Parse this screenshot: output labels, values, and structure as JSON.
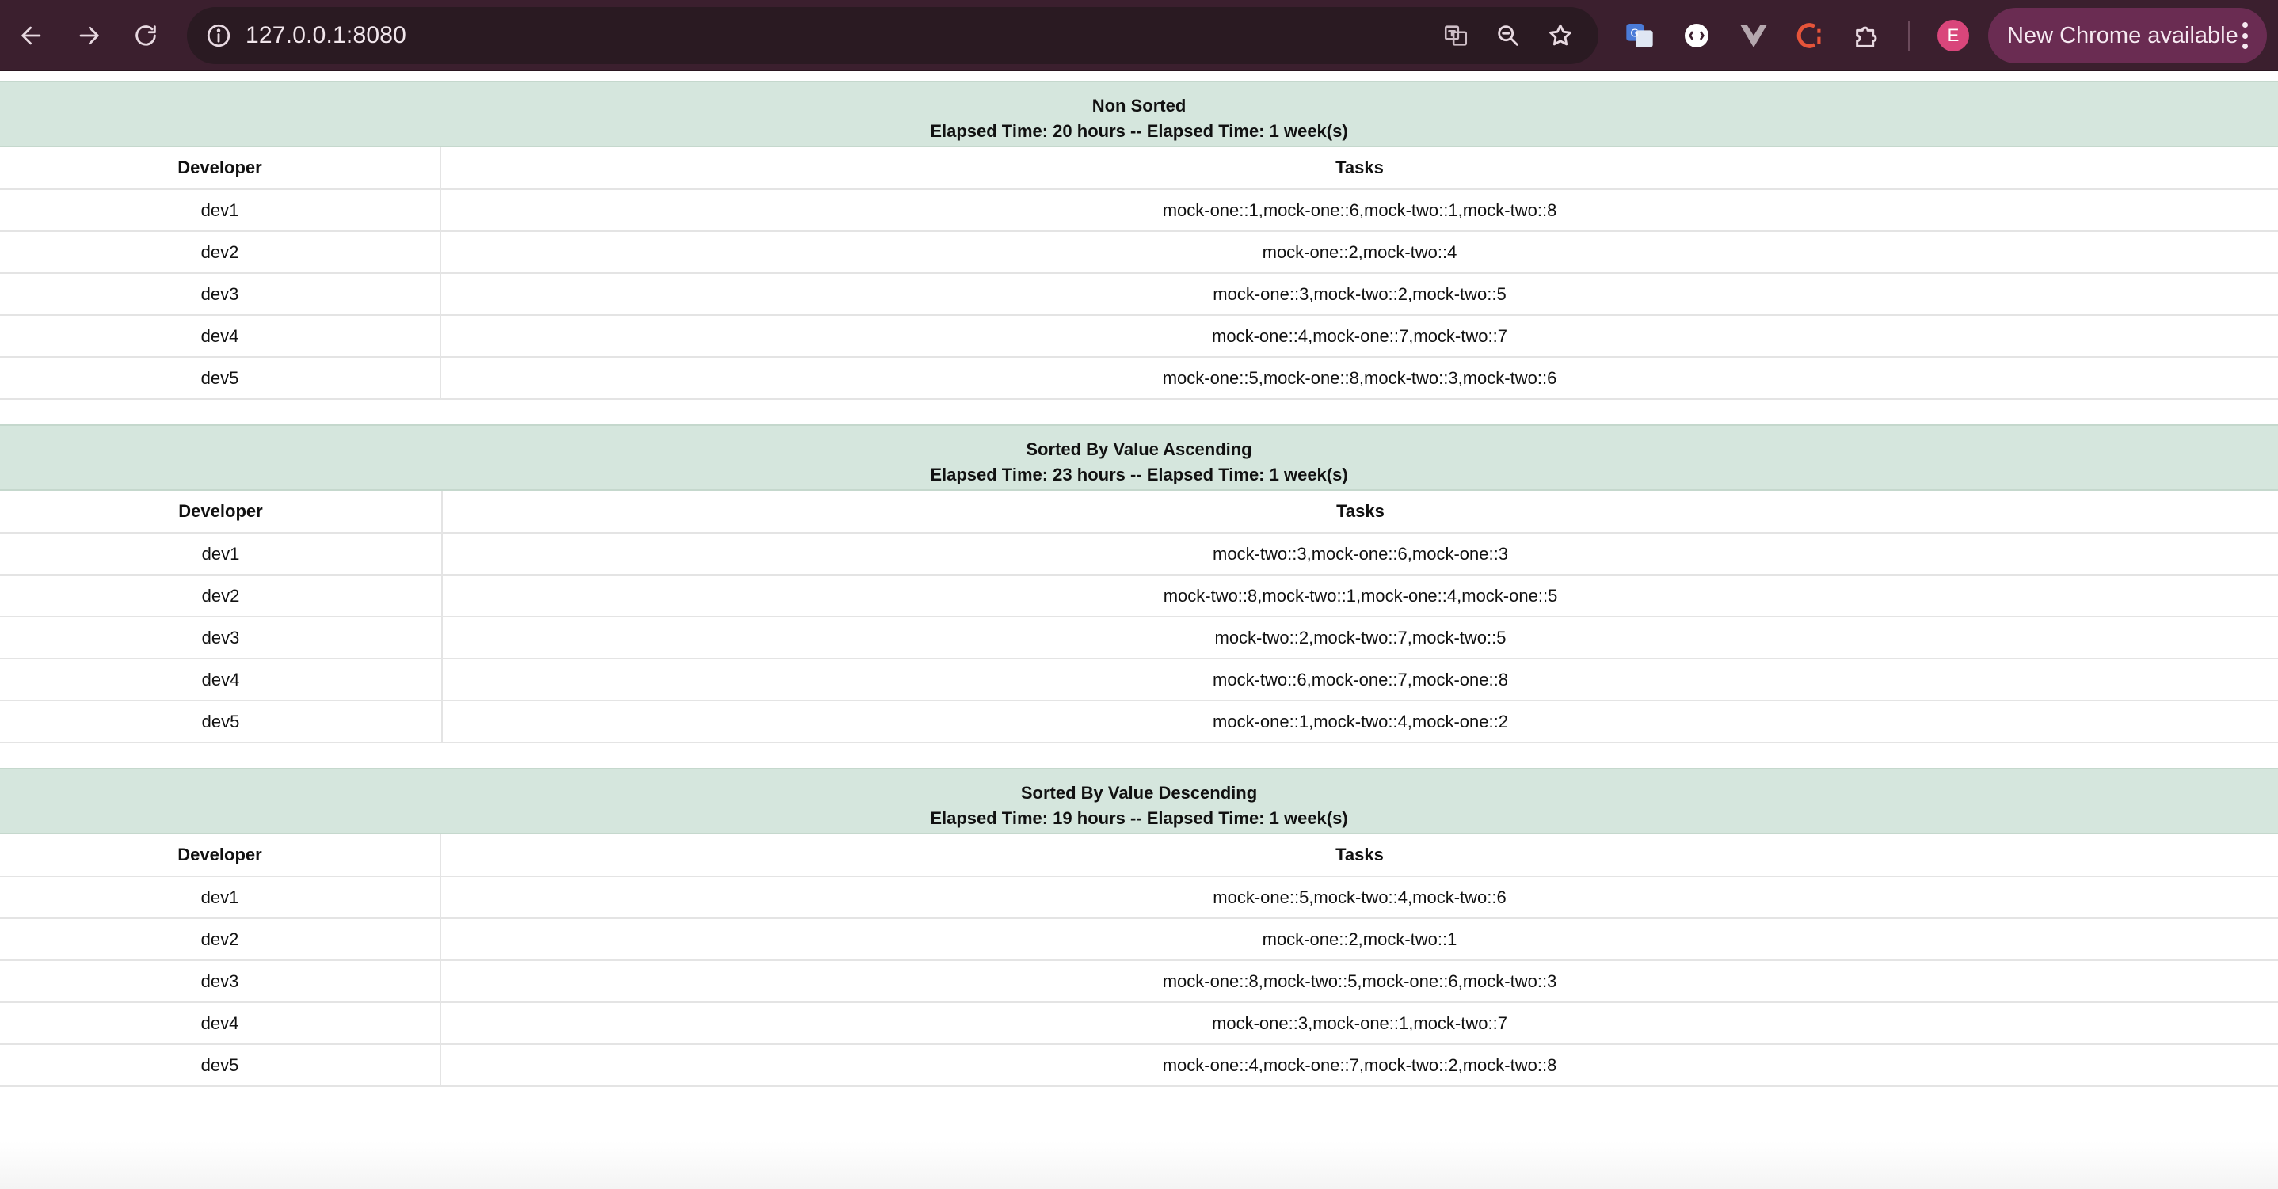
{
  "browser": {
    "url": "127.0.0.1:8080",
    "update_label": "New Chrome available",
    "avatar_letter": "E"
  },
  "sections": [
    {
      "title": "Non Sorted",
      "elapsed": "Elapsed Time: 20 hours -- Elapsed Time: 1 week(s)",
      "columns": [
        "Developer",
        "Tasks"
      ],
      "rows": [
        {
          "dev": "dev1",
          "tasks": "mock-one::1,mock-one::6,mock-two::1,mock-two::8"
        },
        {
          "dev": "dev2",
          "tasks": "mock-one::2,mock-two::4"
        },
        {
          "dev": "dev3",
          "tasks": "mock-one::3,mock-two::2,mock-two::5"
        },
        {
          "dev": "dev4",
          "tasks": "mock-one::4,mock-one::7,mock-two::7"
        },
        {
          "dev": "dev5",
          "tasks": "mock-one::5,mock-one::8,mock-two::3,mock-two::6"
        }
      ]
    },
    {
      "title": "Sorted By Value Ascending",
      "elapsed": "Elapsed Time: 23 hours -- Elapsed Time: 1 week(s)",
      "columns": [
        "Developer",
        "Tasks"
      ],
      "rows": [
        {
          "dev": "dev1",
          "tasks": "mock-two::3,mock-one::6,mock-one::3"
        },
        {
          "dev": "dev2",
          "tasks": "mock-two::8,mock-two::1,mock-one::4,mock-one::5"
        },
        {
          "dev": "dev3",
          "tasks": "mock-two::2,mock-two::7,mock-two::5"
        },
        {
          "dev": "dev4",
          "tasks": "mock-two::6,mock-one::7,mock-one::8"
        },
        {
          "dev": "dev5",
          "tasks": "mock-one::1,mock-two::4,mock-one::2"
        }
      ]
    },
    {
      "title": "Sorted By Value Descending",
      "elapsed": "Elapsed Time: 19 hours -- Elapsed Time: 1 week(s)",
      "columns": [
        "Developer",
        "Tasks"
      ],
      "rows": [
        {
          "dev": "dev1",
          "tasks": "mock-one::5,mock-two::4,mock-two::6"
        },
        {
          "dev": "dev2",
          "tasks": "mock-one::2,mock-two::1"
        },
        {
          "dev": "dev3",
          "tasks": "mock-one::8,mock-two::5,mock-one::6,mock-two::3"
        },
        {
          "dev": "dev4",
          "tasks": "mock-one::3,mock-one::1,mock-two::7"
        },
        {
          "dev": "dev5",
          "tasks": "mock-one::4,mock-one::7,mock-two::2,mock-two::8"
        }
      ]
    }
  ]
}
